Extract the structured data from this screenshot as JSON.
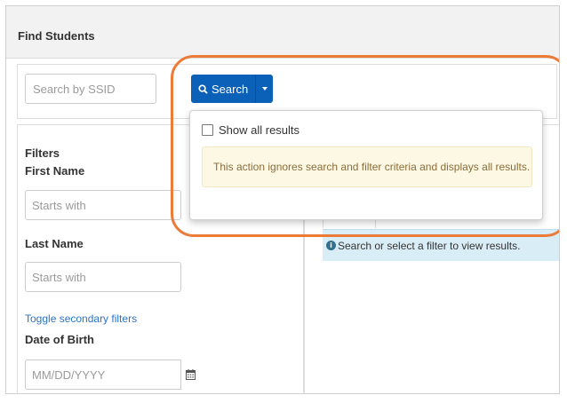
{
  "header": {
    "title": "Find Students"
  },
  "search": {
    "ssid_placeholder": "Search by SSID",
    "button_label": "Search"
  },
  "dropdown": {
    "show_all_label": "Show all results",
    "show_all_checked": false,
    "warning_text": "This action ignores search and filter criteria and displays all results."
  },
  "filters": {
    "title": "Filters",
    "first_name_label": "First Name",
    "first_name_placeholder": "Starts with",
    "last_name_label": "Last Name",
    "last_name_placeholder": "Starts with",
    "toggle_link": "Toggle secondary filters",
    "dob_label": "Date of Birth",
    "dob_placeholder": "MM/DD/YYYY"
  },
  "results": {
    "info_text": "Search or select a filter to view results."
  },
  "colors": {
    "primary_button": "#0b60b8",
    "highlight_ring": "#ec7b37",
    "warning_bg": "#fcf8e3",
    "info_bg": "#d9edf7"
  }
}
